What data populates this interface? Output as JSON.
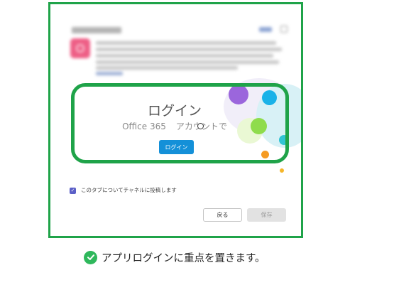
{
  "login": {
    "title": "ログイン",
    "subtitle_prefix": "Office 365",
    "subtitle_suffix": "アカウントで",
    "button_label": "ログイン"
  },
  "options": {
    "post_to_channel_label": "このタブについてチャネルに投稿します",
    "post_to_channel_checked": true
  },
  "footer": {
    "back_label": "戻る",
    "save_label": "保存"
  },
  "caption": {
    "text": "アプリログインに重点を置きます。",
    "icon": "check-circle-icon"
  },
  "colors": {
    "highlight": "#1fa349",
    "primary_button": "#1490d8",
    "checkbox": "#5b5fc7",
    "app_icon": "#ee5f86"
  }
}
